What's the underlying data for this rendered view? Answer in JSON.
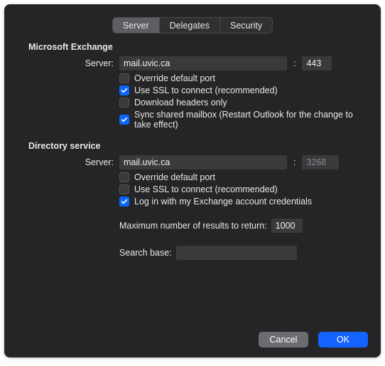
{
  "tabs": {
    "server": "Server",
    "delegates": "Delegates",
    "security": "Security"
  },
  "exchange": {
    "title": "Microsoft Exchange",
    "server_label": "Server:",
    "server_value": "mail.uvic.ca",
    "port_value": "443",
    "override_port": "Override default port",
    "use_ssl": "Use SSL to connect (recommended)",
    "download_headers": "Download headers only",
    "sync_shared": "Sync shared mailbox (Restart Outlook for the change to take effect)"
  },
  "directory": {
    "title": "Directory service",
    "server_label": "Server:",
    "server_value": "mail.uvic.ca",
    "port_value": "3268",
    "override_port": "Override default port",
    "use_ssl": "Use SSL to connect (recommended)",
    "login_exchange": "Log in with my Exchange account credentials",
    "max_results_label": "Maximum number of results to return:",
    "max_results_value": "1000",
    "search_base_label": "Search base:",
    "search_base_value": ""
  },
  "buttons": {
    "cancel": "Cancel",
    "ok": "OK"
  },
  "checkbox_states": {
    "ex_override": false,
    "ex_ssl": true,
    "ex_headers": false,
    "ex_sync": true,
    "dir_override": false,
    "dir_ssl": false,
    "dir_login": true
  }
}
